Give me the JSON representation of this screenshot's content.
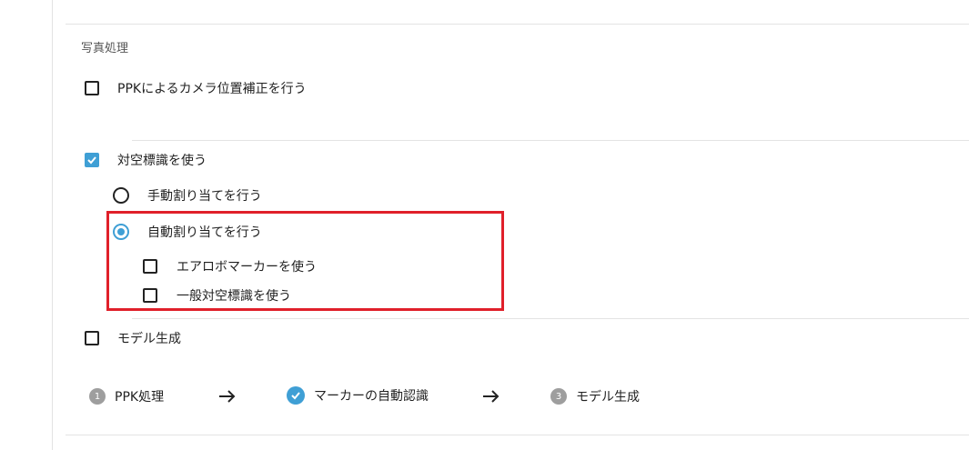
{
  "section": {
    "title": "写真処理"
  },
  "options": {
    "ppk": {
      "label": "PPKによるカメラ位置補正を行う",
      "checked": false
    },
    "gcp": {
      "label": "対空標識を使う",
      "checked": true
    },
    "manual_assign": {
      "label": "手動割り当てを行う",
      "selected": false
    },
    "auto_assign": {
      "label": "自動割り当てを行う",
      "selected": true
    },
    "aerobo_marker": {
      "label": "エアロボマーカーを使う",
      "checked": false
    },
    "general_gcp": {
      "label": "一般対空標識を使う",
      "checked": false
    },
    "model_gen": {
      "label": "モデル生成",
      "checked": false
    }
  },
  "steps": [
    {
      "number": "1",
      "label": "PPK処理",
      "status": "pending",
      "icon": "number-badge"
    },
    {
      "number": "",
      "label": "マーカーの自動認識",
      "status": "done",
      "icon": "check-circle-icon"
    },
    {
      "number": "3",
      "label": "モデル生成",
      "status": "pending",
      "icon": "number-badge"
    }
  ],
  "colors": {
    "accent": "#3f9fd5",
    "highlight": "#e0202a",
    "pending": "#9e9e9e"
  }
}
